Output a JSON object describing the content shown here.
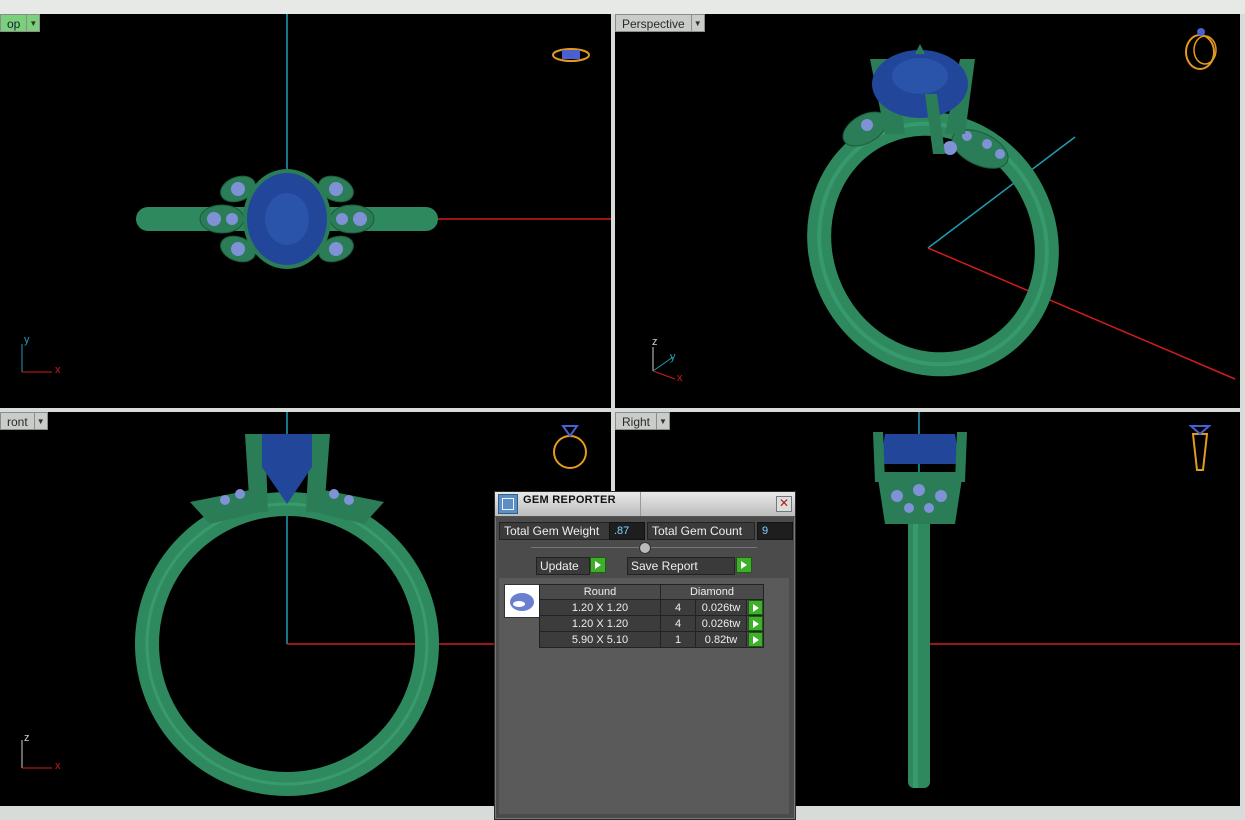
{
  "viewports": {
    "top": {
      "label": "op",
      "axis_y": "y",
      "axis_x": "x"
    },
    "perspective": {
      "label": "Perspective",
      "axis_z": "z",
      "axis_y": "y",
      "axis_x": "x"
    },
    "front": {
      "label": "ront",
      "axis_z": "z",
      "axis_x": "x"
    },
    "right": {
      "label": "Right"
    }
  },
  "gem_reporter": {
    "title": "GEM REPORTER",
    "total_weight_label": "Total Gem Weight",
    "total_weight_value": ".87",
    "total_count_label": "Total Gem Count",
    "total_count_value": "9",
    "update_label": "Update",
    "save_report_label": "Save Report",
    "table": {
      "headers": [
        "Round",
        "Diamond"
      ],
      "rows": [
        {
          "size": "1.20 X 1.20",
          "count": "4",
          "weight": "0.026tw"
        },
        {
          "size": "1.20 X 1.20",
          "count": "4",
          "weight": "0.026tw"
        },
        {
          "size": "5.90 X 5.10",
          "count": "1",
          "weight": "0.82tw"
        }
      ]
    }
  },
  "colors": {
    "metal": "#2e8a5e",
    "gem": "#22479a",
    "accent_gems": "#7f92d6",
    "axis_red": "#d01c1c",
    "axis_cyan": "#1f9db3",
    "nav_icon": "#e39a1f"
  }
}
